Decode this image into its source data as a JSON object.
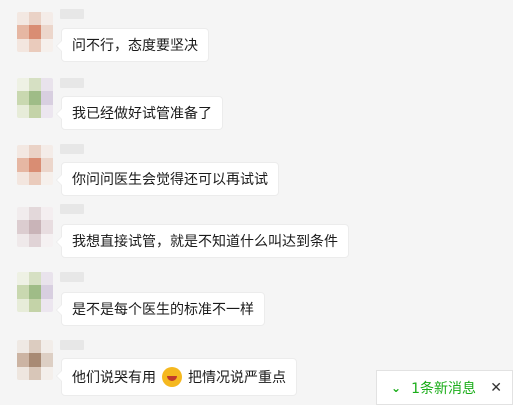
{
  "messages": [
    {
      "text": "问不行，态度要坚决"
    },
    {
      "text": "我已经做好试管准备了"
    },
    {
      "text": "你问问医生会觉得还可以再试试"
    },
    {
      "text": "我想直接试管，就是不知道什么叫达到条件"
    },
    {
      "text": "是不是每个医生的标准不一样"
    },
    {
      "text_before": "他们说哭有用",
      "emoji": "crying-emoji",
      "text_after": "把情况说严重点"
    }
  ],
  "new_message_bar": {
    "chevron": "⌄",
    "label": "1条新消息",
    "close": "✕"
  },
  "colors": {
    "background": "#f5f5f5",
    "bubble": "#ffffff",
    "accent_green": "#1aad19"
  }
}
